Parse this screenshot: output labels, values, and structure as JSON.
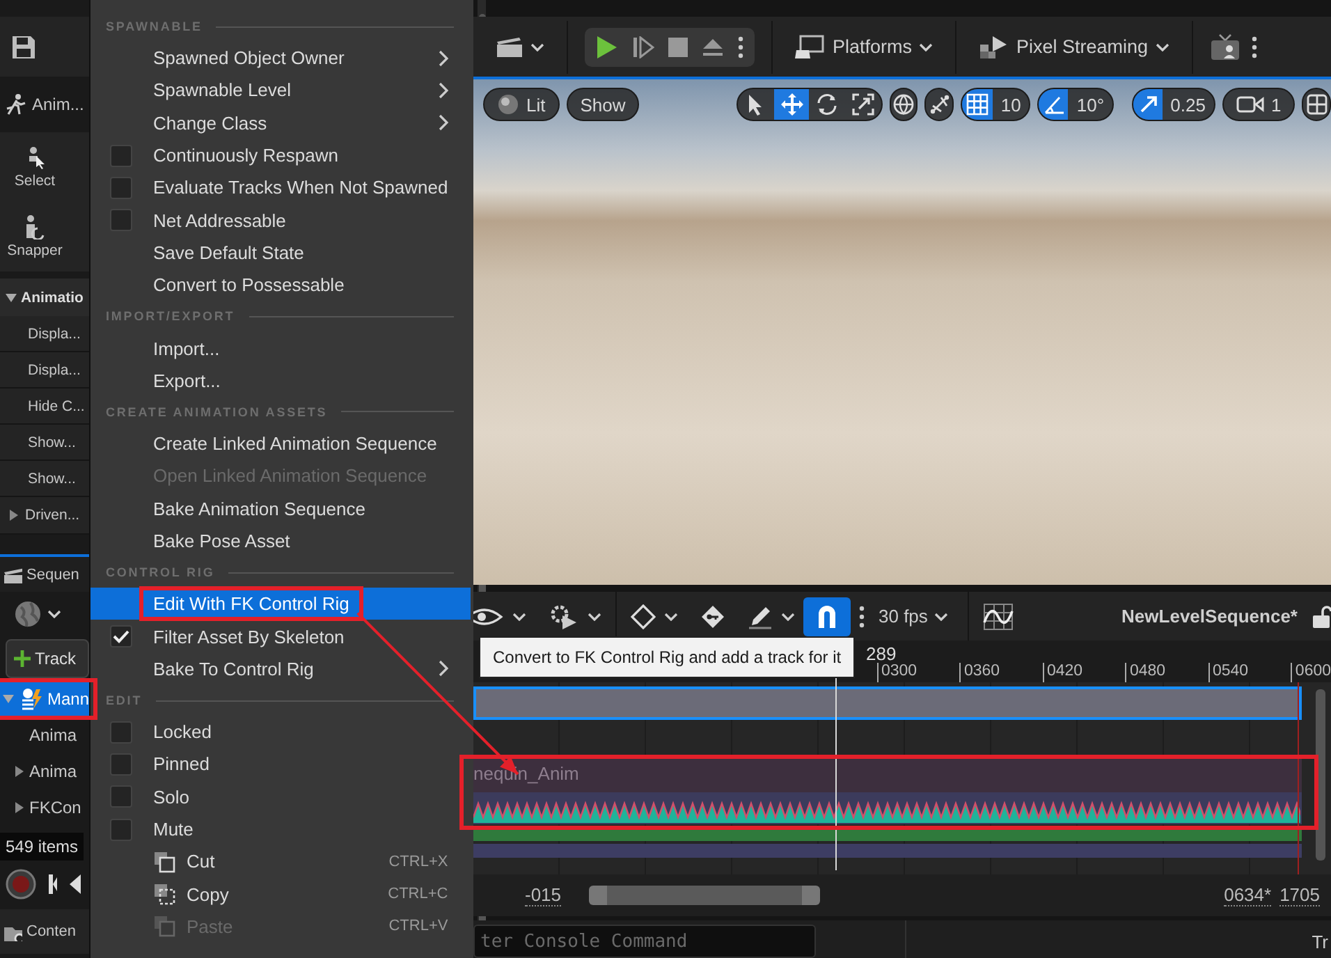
{
  "left_panel": {
    "mode_tab": "Anim...",
    "tools": [
      {
        "kind": "select",
        "label": "Select"
      },
      {
        "kind": "snapper",
        "label": "Snapper"
      }
    ],
    "details": {
      "title": "Animatio",
      "expanded": true,
      "rows": [
        "Displa...",
        "Displa...",
        "Hide C...",
        "Show...",
        "Show..."
      ],
      "group": {
        "label": "Driven...",
        "expanded": false
      }
    },
    "sequencer_tab": "Sequen",
    "add_track_button": "Track",
    "tree": [
      {
        "label": "Mann",
        "selected": true,
        "expanded": true,
        "annotated": true,
        "children": [
          {
            "label": "Anima",
            "selected": false
          },
          {
            "label": "Anima",
            "selected": false,
            "expanded": false
          },
          {
            "label": "FKCon",
            "selected": false,
            "expanded": false
          }
        ]
      }
    ],
    "item_count": "549 items",
    "content_tab": "Conten"
  },
  "context_menu": {
    "sections": [
      {
        "header": "SPAWNABLE",
        "items": [
          {
            "kind": "submenu",
            "label": "Spawned Object Owner",
            "selected": false,
            "disabled": false
          },
          {
            "kind": "submenu",
            "label": "Spawnable Level",
            "selected": false,
            "disabled": false
          },
          {
            "kind": "submenu",
            "label": "Change Class",
            "selected": false,
            "disabled": false
          },
          {
            "kind": "check",
            "label": "Continuously Respawn",
            "checked": false,
            "selected": false,
            "disabled": false
          },
          {
            "kind": "check",
            "label": "Evaluate Tracks When Not Spawned",
            "checked": false,
            "selected": false,
            "disabled": false
          },
          {
            "kind": "check",
            "label": "Net Addressable",
            "checked": false,
            "selected": false,
            "disabled": false
          },
          {
            "kind": "action",
            "label": "Save Default State",
            "selected": false,
            "disabled": false
          },
          {
            "kind": "action",
            "label": "Convert to Possessable",
            "selected": false,
            "disabled": false
          }
        ]
      },
      {
        "header": "IMPORT/EXPORT",
        "items": [
          {
            "kind": "action",
            "label": "Import...",
            "selected": false,
            "disabled": false
          },
          {
            "kind": "action",
            "label": "Export...",
            "selected": false,
            "disabled": false
          }
        ]
      },
      {
        "header": "CREATE ANIMATION ASSETS",
        "items": [
          {
            "kind": "action",
            "label": "Create Linked Animation Sequence",
            "selected": false,
            "disabled": false
          },
          {
            "kind": "action",
            "label": "Open Linked Animation Sequence",
            "selected": false,
            "disabled": true
          },
          {
            "kind": "action",
            "label": "Bake Animation Sequence",
            "selected": false,
            "disabled": false
          },
          {
            "kind": "action",
            "label": "Bake Pose Asset",
            "selected": false,
            "disabled": false
          }
        ]
      },
      {
        "header": "CONTROL RIG",
        "items": [
          {
            "kind": "action",
            "label": "Edit With FK Control Rig",
            "selected": true,
            "disabled": false,
            "annotated": true
          },
          {
            "kind": "check",
            "label": "Filter Asset By Skeleton",
            "checked": true,
            "selected": false,
            "disabled": false
          },
          {
            "kind": "submenu",
            "label": "Bake To Control Rig",
            "selected": false,
            "disabled": false
          }
        ]
      },
      {
        "header": "EDIT",
        "items": [
          {
            "kind": "check",
            "label": "Locked",
            "checked": false,
            "selected": false,
            "disabled": false
          },
          {
            "kind": "check",
            "label": "Pinned",
            "checked": false,
            "selected": false,
            "disabled": false
          },
          {
            "kind": "check",
            "label": "Solo",
            "checked": false,
            "selected": false,
            "disabled": false
          },
          {
            "kind": "check",
            "label": "Mute",
            "checked": false,
            "selected": false,
            "disabled": false
          },
          {
            "kind": "cut",
            "label": "Cut",
            "shortcut": "CTRL+X",
            "selected": false,
            "disabled": false
          },
          {
            "kind": "copy",
            "label": "Copy",
            "shortcut": "CTRL+C",
            "selected": false,
            "disabled": false
          },
          {
            "kind": "paste",
            "label": "Paste",
            "shortcut": "CTRL+V",
            "selected": false,
            "disabled": true
          }
        ]
      }
    ]
  },
  "main_toolbar": {
    "platforms": "Platforms",
    "pixel_streaming": "Pixel Streaming"
  },
  "viewport_toolbar": {
    "view_mode": "Lit",
    "show": "Show",
    "transform_tools": [
      {
        "kind": "select",
        "selected": false
      },
      {
        "kind": "move",
        "selected": true
      },
      {
        "kind": "rotate",
        "selected": false
      },
      {
        "kind": "scale",
        "selected": false
      }
    ],
    "grid_snap": {
      "on": true,
      "value": "10"
    },
    "angle_snap": {
      "on": true,
      "value": "10°"
    },
    "scale_snap": {
      "on": true,
      "value": "0.25"
    },
    "camera_speed": "1"
  },
  "sequencer": {
    "snap_on": true,
    "frame_rate": "30 fps",
    "sequence_name": "NewLevelSequence*",
    "current_frame": "289",
    "ruler_ticks": [
      "0300",
      "0360",
      "0420",
      "0480",
      "0540",
      "0600"
    ],
    "tracks": [
      {
        "kind": "section",
        "selected": true
      },
      {
        "kind": "empty"
      },
      {
        "kind": "anim",
        "label": "nequin_Anim",
        "annotated": true
      },
      {
        "kind": "waveform",
        "annotated": true
      },
      {
        "kind": "bar",
        "color": "#2f7a3c"
      },
      {
        "kind": "bar",
        "color": "#3d3d63"
      }
    ],
    "tooltip": "Convert to FK Control Rig and add a track for it",
    "range_start": "-015",
    "current_end": "0634*",
    "range_end": "1705"
  },
  "console": {
    "placeholder": "ter Console Command"
  },
  "status_bar": {
    "item": "Tr"
  },
  "annotation_arrow": true
}
